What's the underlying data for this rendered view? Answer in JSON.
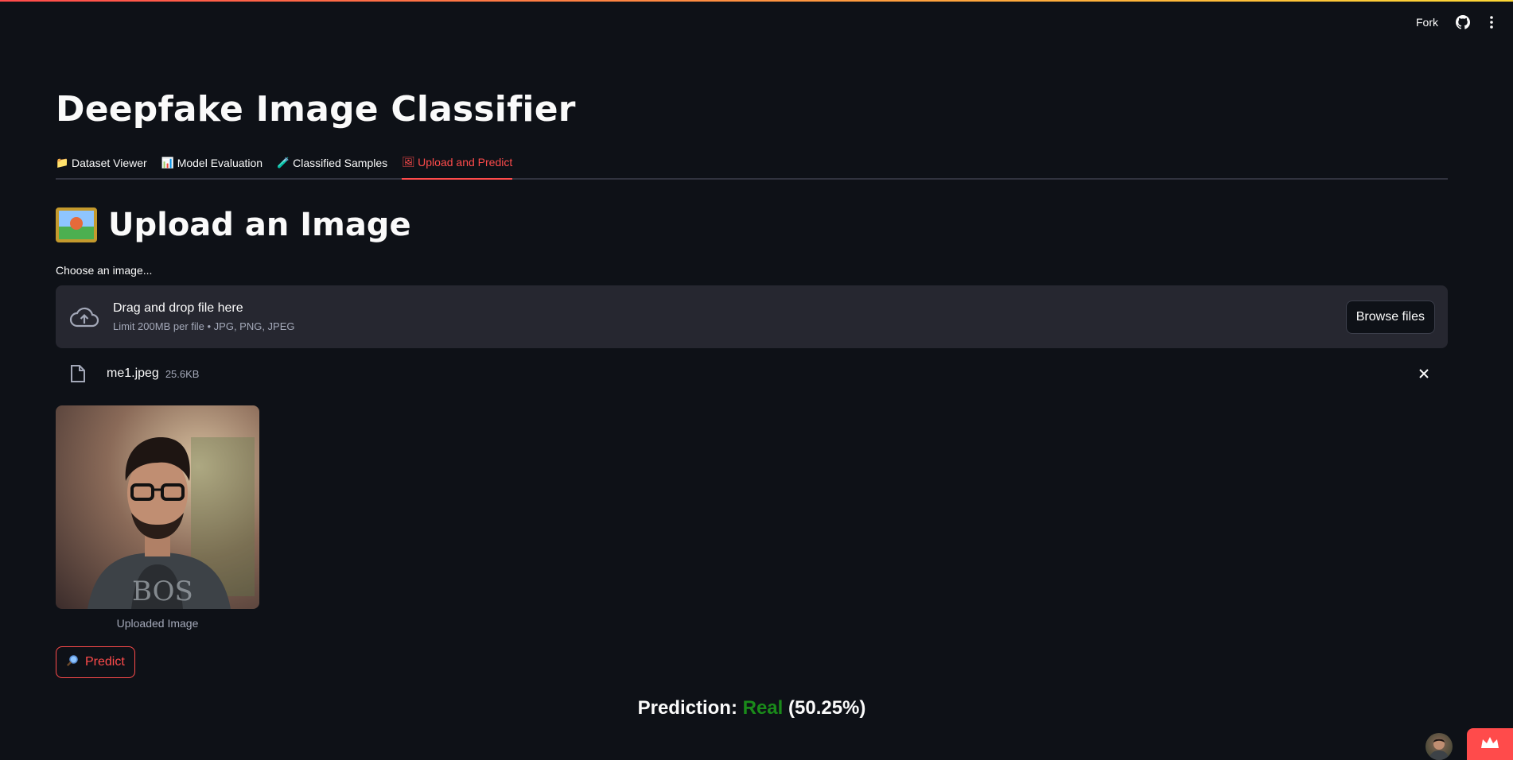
{
  "header": {
    "fork_label": "Fork",
    "github_icon": "github-icon",
    "menu_icon": "more-vertical-icon"
  },
  "app": {
    "title": "Deepfake Image Classifier"
  },
  "tabs": [
    {
      "label": "Dataset Viewer",
      "icon": "folder-icon",
      "glyph": "📁",
      "active": false
    },
    {
      "label": "Model Evaluation",
      "icon": "bar-chart-icon",
      "glyph": "📊",
      "active": false
    },
    {
      "label": "Classified Samples",
      "icon": "test-tube-icon",
      "glyph": "🧪",
      "active": false
    },
    {
      "label": "Upload and Predict",
      "icon": "picture-icon",
      "glyph": "🖼",
      "active": true
    }
  ],
  "upload": {
    "section_title": "Upload an Image",
    "field_label": "Choose an image...",
    "dropzone_main": "Drag and drop file here",
    "dropzone_sub": "Limit 200MB per file • JPG, PNG, JPEG",
    "browse_label": "Browse files",
    "file": {
      "name": "me1.jpeg",
      "size": "25.6KB"
    },
    "image_caption": "Uploaded Image"
  },
  "predict": {
    "button_label": "Predict",
    "icon": "magnifier-icon",
    "result_prefix": "Prediction:",
    "result_label": "Real",
    "result_confidence": "(50.25%)"
  },
  "colors": {
    "background": "#0e1117",
    "accent": "#ff4b4b",
    "dropzone": "#262730",
    "real": "#1a8a1a"
  }
}
